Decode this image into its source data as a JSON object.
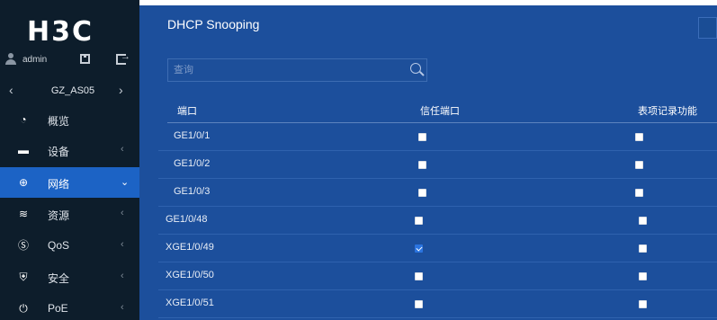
{
  "brand": {
    "logo_text": "H3C"
  },
  "user": {
    "name": "admin",
    "save_icon": "save-icon",
    "logout_icon": "logout-icon"
  },
  "device": {
    "name": "GZ_AS05",
    "prev_glyph": "‹",
    "next_glyph": "›"
  },
  "nav": {
    "items": [
      {
        "label": "概览",
        "icon": "dashboard-icon",
        "glyph": "◔",
        "chevron": ""
      },
      {
        "label": "设备",
        "icon": "device-icon",
        "glyph": "▬",
        "chevron": "‹"
      },
      {
        "label": "网络",
        "icon": "globe-icon",
        "glyph": "⊕",
        "chevron": "⌄"
      },
      {
        "label": "资源",
        "icon": "database-icon",
        "glyph": "≋",
        "chevron": "‹"
      },
      {
        "label": "QoS",
        "icon": "qos-icon",
        "glyph": "Ⓢ",
        "chevron": "‹"
      },
      {
        "label": "安全",
        "icon": "shield-icon",
        "glyph": "⛨",
        "chevron": "‹"
      },
      {
        "label": "PoE",
        "icon": "poe-icon",
        "glyph": "⏻",
        "chevron": "‹"
      }
    ],
    "active_index": 2
  },
  "page": {
    "title": "DHCP Snooping"
  },
  "search": {
    "placeholder": "查询",
    "value": ""
  },
  "table": {
    "headers": {
      "port": "端口",
      "trusted": "信任端口",
      "record": "表项记录功能"
    },
    "rows": [
      {
        "port": "GE1/0/1",
        "trusted": false,
        "record": false
      },
      {
        "port": "GE1/0/2",
        "trusted": false,
        "record": false
      },
      {
        "port": "GE1/0/3",
        "trusted": false,
        "record": false
      },
      {
        "port": "GE1/0/48",
        "trusted": false,
        "record": false
      },
      {
        "port": "XGE1/0/49",
        "trusted": true,
        "record": false
      },
      {
        "port": "XGE1/0/50",
        "trusted": false,
        "record": false
      },
      {
        "port": "XGE1/0/51",
        "trusted": false,
        "record": false
      }
    ]
  },
  "colors": {
    "sidebar_bg": "#0d1d2b",
    "nav_active": "#1c63c5",
    "main_bg": "#1c4f9c",
    "checkbox_checked": "#2b74df"
  }
}
